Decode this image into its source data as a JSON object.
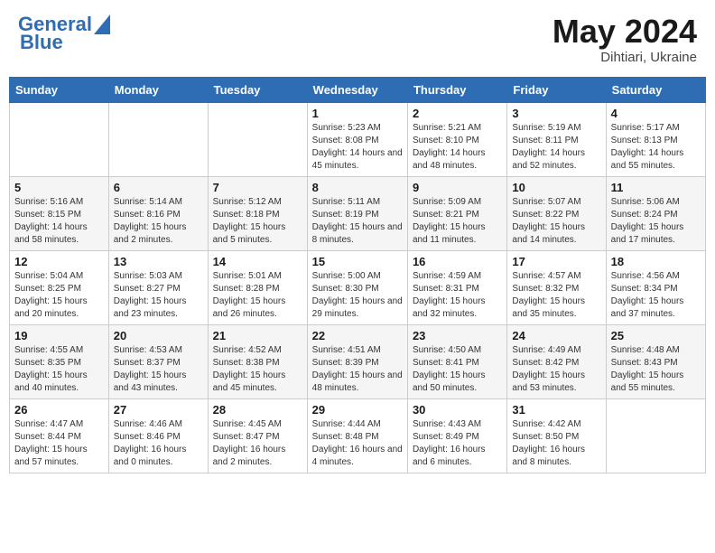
{
  "header": {
    "logo_line1": "General",
    "logo_line2": "Blue",
    "month_title": "May 2024",
    "subtitle": "Dihtiari, Ukraine"
  },
  "columns": [
    "Sunday",
    "Monday",
    "Tuesday",
    "Wednesday",
    "Thursday",
    "Friday",
    "Saturday"
  ],
  "weeks": [
    [
      {
        "day": "",
        "info": ""
      },
      {
        "day": "",
        "info": ""
      },
      {
        "day": "",
        "info": ""
      },
      {
        "day": "1",
        "info": "Sunrise: 5:23 AM\nSunset: 8:08 PM\nDaylight: 14 hours and 45 minutes."
      },
      {
        "day": "2",
        "info": "Sunrise: 5:21 AM\nSunset: 8:10 PM\nDaylight: 14 hours and 48 minutes."
      },
      {
        "day": "3",
        "info": "Sunrise: 5:19 AM\nSunset: 8:11 PM\nDaylight: 14 hours and 52 minutes."
      },
      {
        "day": "4",
        "info": "Sunrise: 5:17 AM\nSunset: 8:13 PM\nDaylight: 14 hours and 55 minutes."
      }
    ],
    [
      {
        "day": "5",
        "info": "Sunrise: 5:16 AM\nSunset: 8:15 PM\nDaylight: 14 hours and 58 minutes."
      },
      {
        "day": "6",
        "info": "Sunrise: 5:14 AM\nSunset: 8:16 PM\nDaylight: 15 hours and 2 minutes."
      },
      {
        "day": "7",
        "info": "Sunrise: 5:12 AM\nSunset: 8:18 PM\nDaylight: 15 hours and 5 minutes."
      },
      {
        "day": "8",
        "info": "Sunrise: 5:11 AM\nSunset: 8:19 PM\nDaylight: 15 hours and 8 minutes."
      },
      {
        "day": "9",
        "info": "Sunrise: 5:09 AM\nSunset: 8:21 PM\nDaylight: 15 hours and 11 minutes."
      },
      {
        "day": "10",
        "info": "Sunrise: 5:07 AM\nSunset: 8:22 PM\nDaylight: 15 hours and 14 minutes."
      },
      {
        "day": "11",
        "info": "Sunrise: 5:06 AM\nSunset: 8:24 PM\nDaylight: 15 hours and 17 minutes."
      }
    ],
    [
      {
        "day": "12",
        "info": "Sunrise: 5:04 AM\nSunset: 8:25 PM\nDaylight: 15 hours and 20 minutes."
      },
      {
        "day": "13",
        "info": "Sunrise: 5:03 AM\nSunset: 8:27 PM\nDaylight: 15 hours and 23 minutes."
      },
      {
        "day": "14",
        "info": "Sunrise: 5:01 AM\nSunset: 8:28 PM\nDaylight: 15 hours and 26 minutes."
      },
      {
        "day": "15",
        "info": "Sunrise: 5:00 AM\nSunset: 8:30 PM\nDaylight: 15 hours and 29 minutes."
      },
      {
        "day": "16",
        "info": "Sunrise: 4:59 AM\nSunset: 8:31 PM\nDaylight: 15 hours and 32 minutes."
      },
      {
        "day": "17",
        "info": "Sunrise: 4:57 AM\nSunset: 8:32 PM\nDaylight: 15 hours and 35 minutes."
      },
      {
        "day": "18",
        "info": "Sunrise: 4:56 AM\nSunset: 8:34 PM\nDaylight: 15 hours and 37 minutes."
      }
    ],
    [
      {
        "day": "19",
        "info": "Sunrise: 4:55 AM\nSunset: 8:35 PM\nDaylight: 15 hours and 40 minutes."
      },
      {
        "day": "20",
        "info": "Sunrise: 4:53 AM\nSunset: 8:37 PM\nDaylight: 15 hours and 43 minutes."
      },
      {
        "day": "21",
        "info": "Sunrise: 4:52 AM\nSunset: 8:38 PM\nDaylight: 15 hours and 45 minutes."
      },
      {
        "day": "22",
        "info": "Sunrise: 4:51 AM\nSunset: 8:39 PM\nDaylight: 15 hours and 48 minutes."
      },
      {
        "day": "23",
        "info": "Sunrise: 4:50 AM\nSunset: 8:41 PM\nDaylight: 15 hours and 50 minutes."
      },
      {
        "day": "24",
        "info": "Sunrise: 4:49 AM\nSunset: 8:42 PM\nDaylight: 15 hours and 53 minutes."
      },
      {
        "day": "25",
        "info": "Sunrise: 4:48 AM\nSunset: 8:43 PM\nDaylight: 15 hours and 55 minutes."
      }
    ],
    [
      {
        "day": "26",
        "info": "Sunrise: 4:47 AM\nSunset: 8:44 PM\nDaylight: 15 hours and 57 minutes."
      },
      {
        "day": "27",
        "info": "Sunrise: 4:46 AM\nSunset: 8:46 PM\nDaylight: 16 hours and 0 minutes."
      },
      {
        "day": "28",
        "info": "Sunrise: 4:45 AM\nSunset: 8:47 PM\nDaylight: 16 hours and 2 minutes."
      },
      {
        "day": "29",
        "info": "Sunrise: 4:44 AM\nSunset: 8:48 PM\nDaylight: 16 hours and 4 minutes."
      },
      {
        "day": "30",
        "info": "Sunrise: 4:43 AM\nSunset: 8:49 PM\nDaylight: 16 hours and 6 minutes."
      },
      {
        "day": "31",
        "info": "Sunrise: 4:42 AM\nSunset: 8:50 PM\nDaylight: 16 hours and 8 minutes."
      },
      {
        "day": "",
        "info": ""
      }
    ]
  ]
}
